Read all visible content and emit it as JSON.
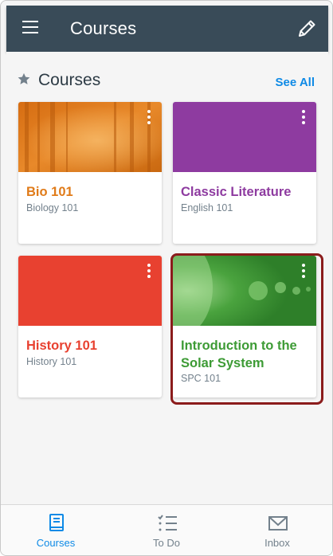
{
  "appbar": {
    "title": "Courses",
    "menu_icon": "hamburger-menu-icon",
    "edit_icon": "pencil-icon"
  },
  "section": {
    "icon": "star-icon",
    "title": "Courses",
    "see_all": "See All"
  },
  "courses": [
    {
      "title": "Bio 101",
      "code": "Biology 101",
      "color": "#e07b19",
      "image": "forest-photo"
    },
    {
      "title": "Classic Literature",
      "code": "English 101",
      "color": "#8e3ba0"
    },
    {
      "title": "History 101",
      "code": "History 101",
      "color": "#e84130"
    },
    {
      "title": "Introduction to the Solar System",
      "code": "SPC 101",
      "color": "#3d9b35",
      "image": "planets-photo"
    }
  ],
  "bottom_nav": [
    {
      "label": "Courses",
      "icon": "book-icon",
      "active": true,
      "color": "#0e8ae6"
    },
    {
      "label": "To Do",
      "icon": "checklist-icon",
      "active": false,
      "color": "#73818c"
    },
    {
      "label": "Inbox",
      "icon": "envelope-icon",
      "active": false,
      "color": "#73818c"
    }
  ]
}
